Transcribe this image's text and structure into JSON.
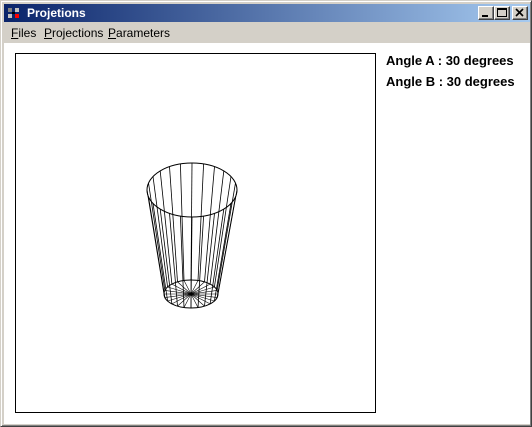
{
  "window": {
    "title": "Projetions"
  },
  "menu": [
    {
      "label": "Files"
    },
    {
      "label": "Projections"
    },
    {
      "label": "Parameters"
    }
  ],
  "info": {
    "angle_a": "Angle A : 30 degrees",
    "angle_b": "Angle B : 30 degrees"
  },
  "model": {
    "shape": "truncated-cone-wireframe",
    "segments": 24,
    "colors": {
      "stroke": "#000000",
      "background": "#ffffff"
    }
  },
  "icons": [
    "app-icon",
    "minimize-icon",
    "maximize-icon",
    "close-icon"
  ]
}
